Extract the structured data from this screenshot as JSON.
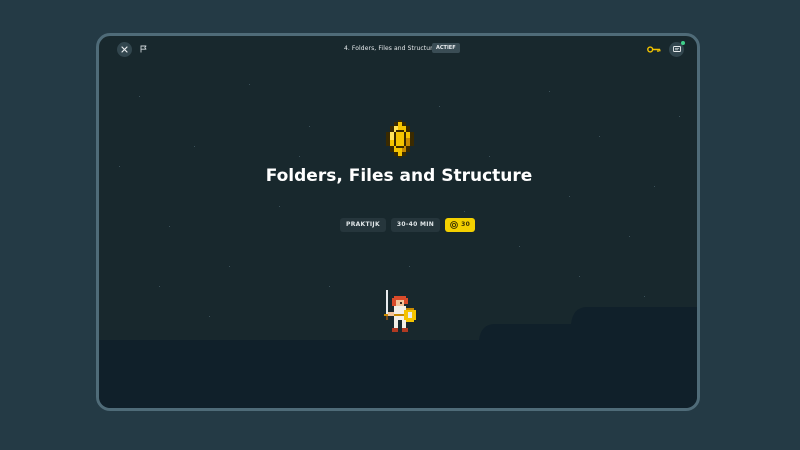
{
  "header": {
    "lesson_title": "4. Folders, Files and Structure",
    "status": "ACTIEF",
    "close_icon": "close-icon",
    "flag_icon": "flag-icon",
    "key_icon": "key-icon",
    "chat_icon": "chat-icon",
    "chat_has_notification": true
  },
  "hero_section": {
    "badge_icon": "coin-icon",
    "title": "Folders, Files and Structure",
    "tags": {
      "type": "PRAKTIJK",
      "duration": "30-40 MIN",
      "reward_value": "30"
    }
  },
  "colors": {
    "page_bg": "#243a45",
    "device_border": "#4f6b78",
    "sky": "#18282d",
    "ground": "#10202a",
    "reward_yellow": "#f3d000",
    "notification_green": "#3fd08a"
  }
}
